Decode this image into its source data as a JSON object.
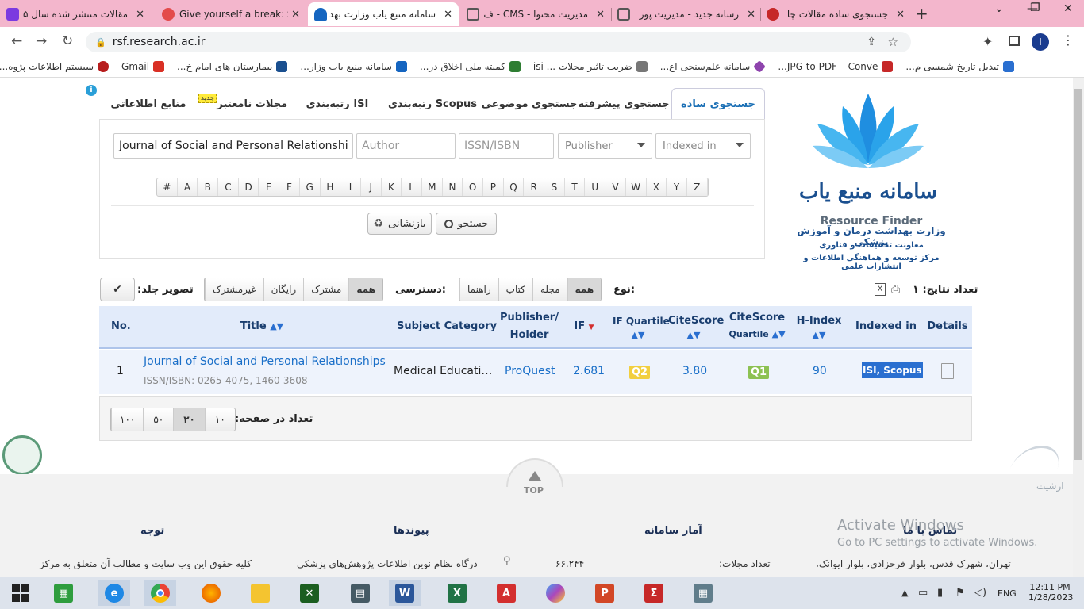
{
  "browser": {
    "tabs": [
      {
        "title": "مقالات منتشر شده سال ۵",
        "color": "#7b3ae0"
      },
      {
        "title": "Give yourself a break: S",
        "color": "#e34b4b"
      },
      {
        "title": "سامانه منبع یاب وزارت بهد",
        "color": "#1565c0"
      },
      {
        "title": "مدیریت محتوا - CMS - ف",
        "color": "#555555"
      },
      {
        "title": "رسانه جدید - مدیریت پور",
        "color": "#555555"
      },
      {
        "title": "جستجوی ساده مقالات چا",
        "color": "#c62828"
      }
    ],
    "new_tab": "+",
    "url": "rsf.research.ac.ir",
    "profile_initial": "I",
    "bookmarks": [
      {
        "label": "تبدیل تاریخ شمسی م...",
        "color": "#2a6fd0"
      },
      {
        "label": "JPG to PDF – Conve...",
        "color": "#c62828"
      },
      {
        "label": "سامانه علم‌سنجی اع...",
        "color": "#8e44ad"
      },
      {
        "label": "ضریب تاثیر مجلات ... isi",
        "color": "#777777"
      },
      {
        "label": "کمیته ملی اخلاق در...",
        "color": "#2e7d32"
      },
      {
        "label": "سامانه منبع یاب وزار...",
        "color": "#1565c0"
      },
      {
        "label": "بیمارستان های امام خ...",
        "color": "#1a4f8f"
      },
      {
        "label": "Gmail",
        "color": "#d93025"
      },
      {
        "label": "سیستم اطلاعات پژوه...",
        "color": "#b71c1c"
      }
    ]
  },
  "search_tabs": {
    "simple": "جستجوی ساده",
    "advanced": "جستجوی پیشرفته",
    "subject": "جستجوی موضوعی",
    "scopus": "رتبه‌بندی Scopus",
    "isi": "رتبه‌بندی ISI",
    "valid": "مجلات نامعتبر",
    "new_badge": "جدید",
    "sources": "منابع اطلاعاتی",
    "info_icon": "i"
  },
  "search": {
    "title_value": "Journal of Social and Personal Relationshi",
    "author_placeholder": "Author",
    "issn_placeholder": "ISSN/ISBN",
    "publisher_placeholder": "Publisher",
    "indexed_placeholder": "Indexed in",
    "alphabet": [
      "#",
      "A",
      "B",
      "C",
      "D",
      "E",
      "F",
      "G",
      "H",
      "I",
      "J",
      "K",
      "L",
      "M",
      "N",
      "O",
      "P",
      "Q",
      "R",
      "S",
      "T",
      "U",
      "V",
      "W",
      "X",
      "Y",
      "Z"
    ],
    "search_button": "جستجو",
    "reset_button": "بازنشانی"
  },
  "logo": {
    "title_fa": "سامانه منبع یاب",
    "title_en": "Resource Finder",
    "ministry": "وزارت بهداشت درمان و آموزش پزشکی",
    "deputy": "معاونت تحقیقات و فناوری",
    "center": "مرکز توسعه و هماهنگی اطلاعات و انتشارات علمی"
  },
  "toolbar": {
    "results_label": "تعداد نتایج: ۱",
    "type_label": "نوع:",
    "type_options": [
      "همه",
      "مجله",
      "کتاب",
      "راهنما"
    ],
    "access_label": "دسترسی:",
    "access_options": [
      "همه",
      "مشترک",
      "رایگان",
      "غیرمشترک"
    ],
    "cover_label": "تصویر جلد:"
  },
  "table": {
    "headers": {
      "no": "No.",
      "title": "Title",
      "subject": "Subject Category",
      "publisher_1": "Publisher/",
      "publisher_2": "Holder",
      "if": "IF",
      "if_quartile": "IF Quartile",
      "citescore": "CiteScore",
      "cs_quartile_1": "CiteScore",
      "cs_quartile_2": "Quartile",
      "hindex": "H-Index",
      "indexed": "Indexed in",
      "details": "Details"
    },
    "rows": [
      {
        "no": "1",
        "title": "Journal of Social and Personal Relationships",
        "issn": "ISSN/ISBN: 0265-4075, 1460-3608",
        "subject": "Medical Educati…",
        "publisher": "ProQuest",
        "if": "2.681",
        "if_quartile": "Q2",
        "citescore": "3.80",
        "cs_quartile": "Q1",
        "hindex": "90",
        "indexed": "ISI, Scopus"
      }
    ]
  },
  "pager": {
    "label": "تعداد در صفحه:",
    "options": [
      "۱۰",
      "۲۰",
      "۵۰",
      "۱۰۰"
    ]
  },
  "footer": {
    "top": "TOP",
    "archive": "ارشیت",
    "contact_title": "تماس با ما",
    "contact_text": "تهران، شهرک قدس، بلوار فرحزادی، بلوار ایوانک،",
    "stats_title": "آمار سامانه",
    "stats_label": "تعداد مجلات:",
    "stats_value": "۶۶.۲۴۴",
    "links_title": "پیوندها",
    "link_1": "درگاه نظام نوین اطلاعات پژوهش‌های پزشکی",
    "note_title": "توجه",
    "note_text": "کلیه حقوق این وب سایت و مطالب آن متعلق به مرکز",
    "activate_1": "Activate Windows",
    "activate_2": "Go to PC settings to activate Windows."
  },
  "taskbar": {
    "time": "12:11 PM",
    "date": "1/28/2023",
    "lang": "ENG"
  }
}
